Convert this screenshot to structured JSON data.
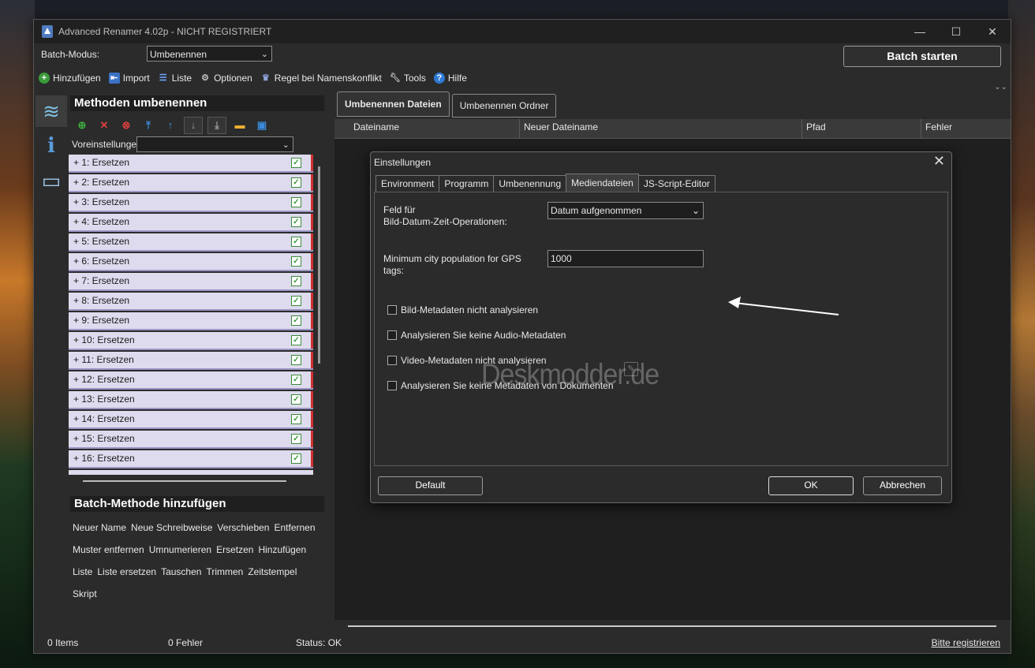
{
  "window": {
    "title": "Advanced Renamer 4.02p - NICHT REGISTRIERT"
  },
  "controls": {
    "minimize": "—",
    "maximize": "☐",
    "close": "✕"
  },
  "batch_mode": {
    "label": "Batch-Modus:",
    "value": "Umbenennen"
  },
  "batch_start": "Batch starten",
  "toolbar": {
    "add": "Hinzufügen",
    "import": "Import",
    "list": "Liste",
    "options": "Optionen",
    "conflict_rule": "Regel bei Namenskonflikt",
    "tools": "Tools",
    "help": "Hilfe"
  },
  "methods": {
    "title": "Methoden umbenennen",
    "presets_label": "Voreinstellungen",
    "presets_value": "",
    "items": [
      "+ 1: Ersetzen",
      "+ 2: Ersetzen",
      "+ 3: Ersetzen",
      "+ 4: Ersetzen",
      "+ 5: Ersetzen",
      "+ 6: Ersetzen",
      "+ 7: Ersetzen",
      "+ 8: Ersetzen",
      "+ 9: Ersetzen",
      "+ 10: Ersetzen",
      "+ 11: Ersetzen",
      "+ 12: Ersetzen",
      "+ 13: Ersetzen",
      "+ 14: Ersetzen",
      "+ 15: Ersetzen",
      "+ 16: Ersetzen"
    ]
  },
  "batch_methods": {
    "title": "Batch-Methode hinzufügen",
    "rows": [
      [
        "Neuer Name",
        "Neue Schreibweise",
        "Verschieben",
        "Entfernen"
      ],
      [
        "Muster entfernen",
        "Umnumerieren",
        "Ersetzen",
        "Hinzufügen"
      ],
      [
        "Liste",
        "Liste ersetzen",
        "Tauschen",
        "Trimmen",
        "Zeitstempel"
      ],
      [
        "Skript"
      ]
    ]
  },
  "main_tabs": [
    "Umbenennen Dateien",
    "Umbenennen Ordner"
  ],
  "grid_columns": [
    "Dateiname",
    "Neuer Dateiname",
    "Pfad",
    "Fehler"
  ],
  "status": {
    "items": "0 Items",
    "errors": "0 Fehler",
    "status": "Status: OK",
    "register": "Bitte registrieren"
  },
  "dialog": {
    "title": "Einstellungen",
    "close": "✕",
    "tabs": [
      "Environment",
      "Programm",
      "Umbenennung",
      "Mediendateien",
      "JS-Script-Editor"
    ],
    "active_tab": "Mediendateien",
    "field_label_1": "Feld für",
    "field_label_2": "Bild-Datum-Zeit-Operationen:",
    "field_value": "Datum aufgenommen",
    "gps_label_1": "Minimum city population for GPS",
    "gps_label_2": "tags:",
    "gps_value": "1000",
    "checkboxes": [
      "Bild-Metadaten nicht analysieren",
      "Analysieren Sie keine Audio-Metadaten",
      "Video-Metadaten nicht analysieren",
      "Analysieren Sie keine Metadaten von Dokumenten"
    ],
    "watermark": "Deskmodder.de",
    "btn_default": "Default",
    "btn_ok": "OK",
    "btn_cancel": "Abbrechen"
  }
}
